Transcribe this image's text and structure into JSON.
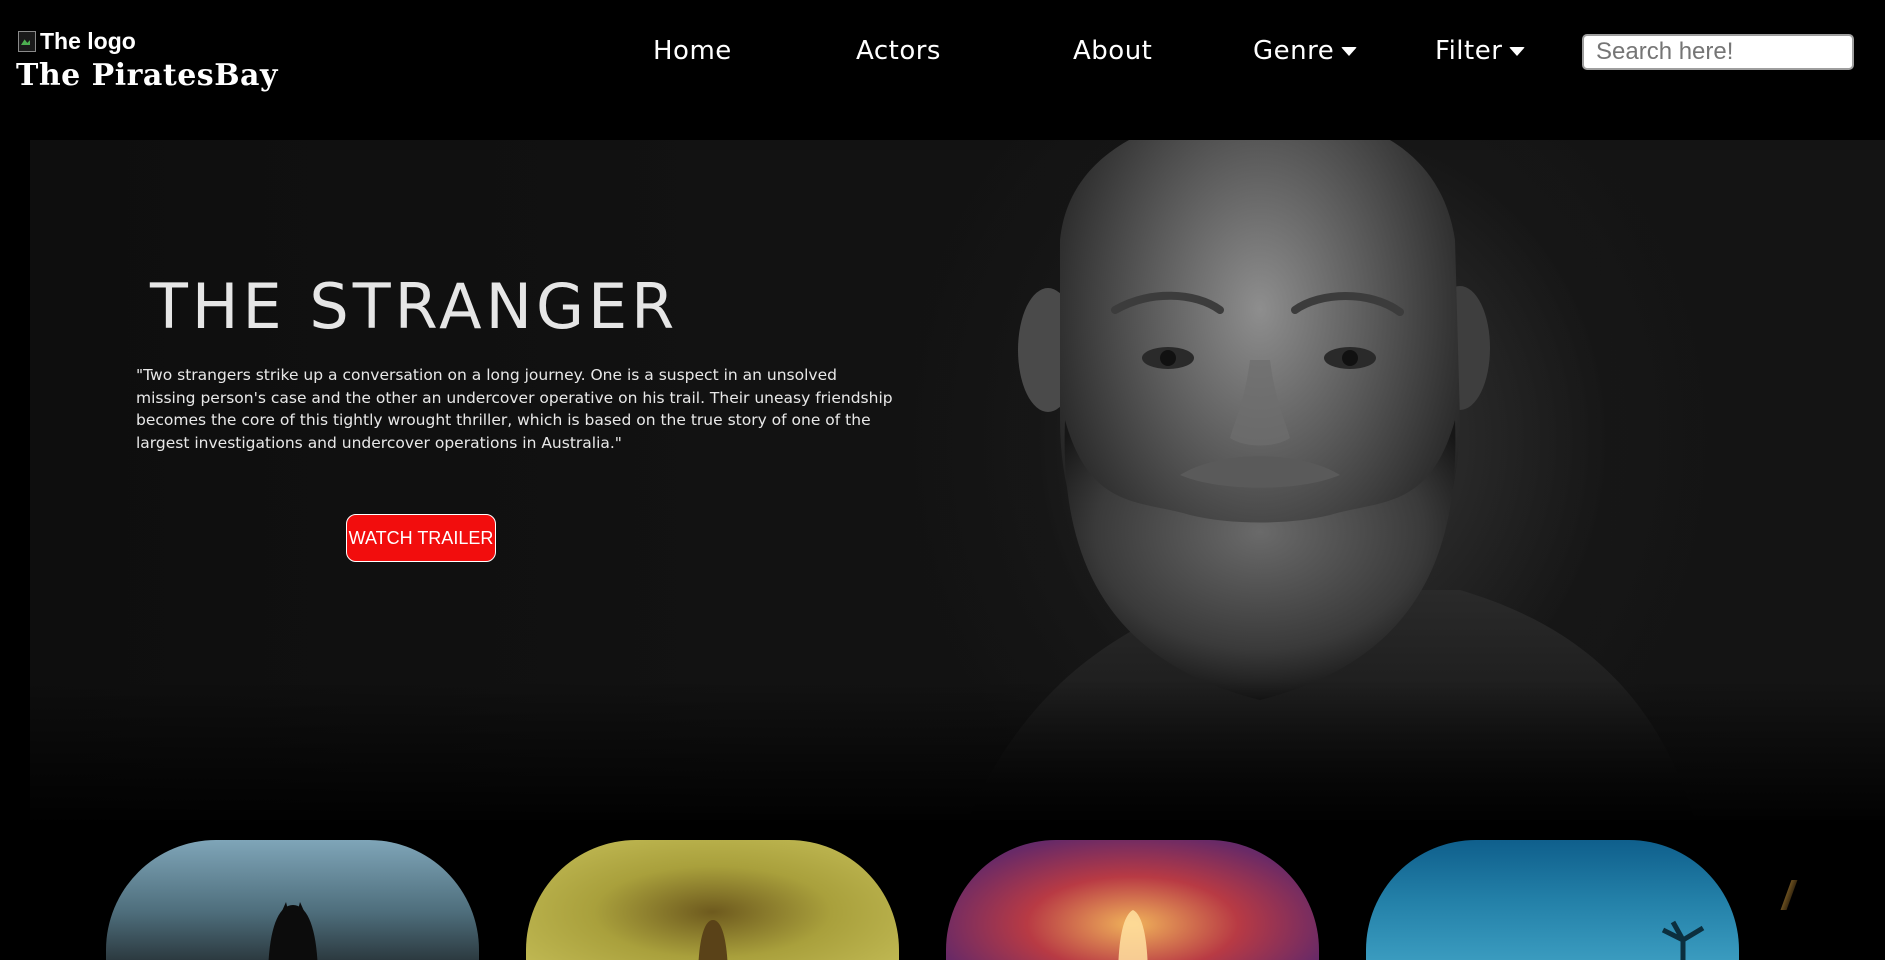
{
  "header": {
    "logo_alt": "The logo",
    "site_name": "The PiratesBay",
    "nav": [
      {
        "label": "Home",
        "has_dropdown": false
      },
      {
        "label": "Actors",
        "has_dropdown": false
      },
      {
        "label": "About",
        "has_dropdown": false
      },
      {
        "label": "Genre",
        "has_dropdown": true
      },
      {
        "label": "Filter",
        "has_dropdown": true
      }
    ],
    "search": {
      "placeholder": "Search here!",
      "value": ""
    }
  },
  "hero": {
    "title": "THE STRANGER",
    "description": "\"Two strangers strike up a conversation on a long journey. One is a suspect in an unsolved missing person's case and the other an undercover operative on his trail. Their uneasy friendship becomes the core of this tightly wrought thriller, which is based on the true story of one of the largest investigations and undercover operations in Australia.\"",
    "button_label": "WATCH TRAILER"
  },
  "colors": {
    "background": "#000000",
    "accent_button": "#f20d0d",
    "text": "#ffffff"
  },
  "icons": {
    "dropdown": "caret-down-icon",
    "broken_logo": "broken-image-icon"
  }
}
